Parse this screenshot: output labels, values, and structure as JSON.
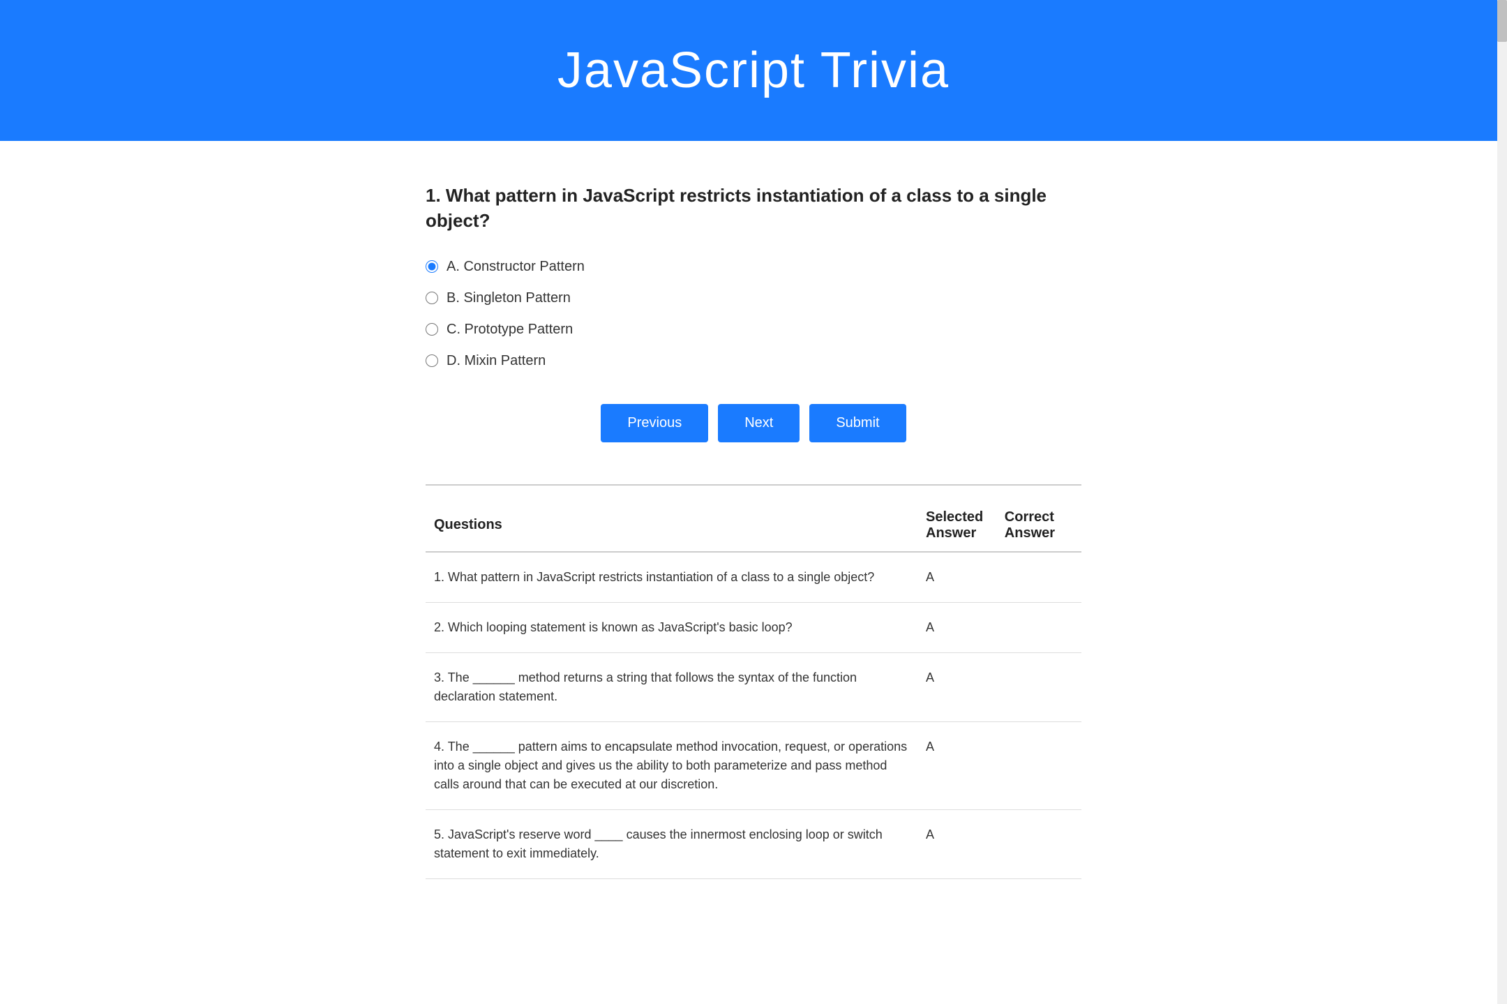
{
  "header": {
    "title": "JavaScript Trivia"
  },
  "question": {
    "number": 1,
    "text": "What pattern in JavaScript restricts instantiation of a class to a single object?",
    "full_text": "1. What pattern in JavaScript restricts instantiation of a class to a single object?",
    "options": [
      {
        "id": "opt-a",
        "value": "A",
        "label": "A. Constructor Pattern",
        "checked": true
      },
      {
        "id": "opt-b",
        "value": "B",
        "label": "B. Singleton Pattern",
        "checked": false
      },
      {
        "id": "opt-c",
        "value": "C",
        "label": "C. Prototype Pattern",
        "checked": false
      },
      {
        "id": "opt-d",
        "value": "D",
        "label": "D. Mixin Pattern",
        "checked": false
      }
    ]
  },
  "buttons": {
    "previous": "Previous",
    "next": "Next",
    "submit": "Submit"
  },
  "table": {
    "headers": {
      "question": "Questions",
      "selected": "Selected Answer",
      "correct": "Correct Answer"
    },
    "rows": [
      {
        "question": "1. What pattern in JavaScript restricts instantiation of a class to a single object?",
        "selected": "A",
        "correct": ""
      },
      {
        "question": "2. Which looping statement is known as JavaScript's basic loop?",
        "selected": "A",
        "correct": ""
      },
      {
        "question": "3. The ______ method returns a string that follows the syntax of the function declaration statement.",
        "selected": "A",
        "correct": ""
      },
      {
        "question": "4. The ______ pattern aims to encapsulate method invocation, request, or operations into a single object and gives us the ability to both parameterize and pass method calls around that can be executed at our discretion.",
        "selected": "A",
        "correct": ""
      },
      {
        "question": "5. JavaScript's reserve word ____ causes the innermost enclosing loop or switch statement to exit immediately.",
        "selected": "A",
        "correct": ""
      }
    ]
  }
}
